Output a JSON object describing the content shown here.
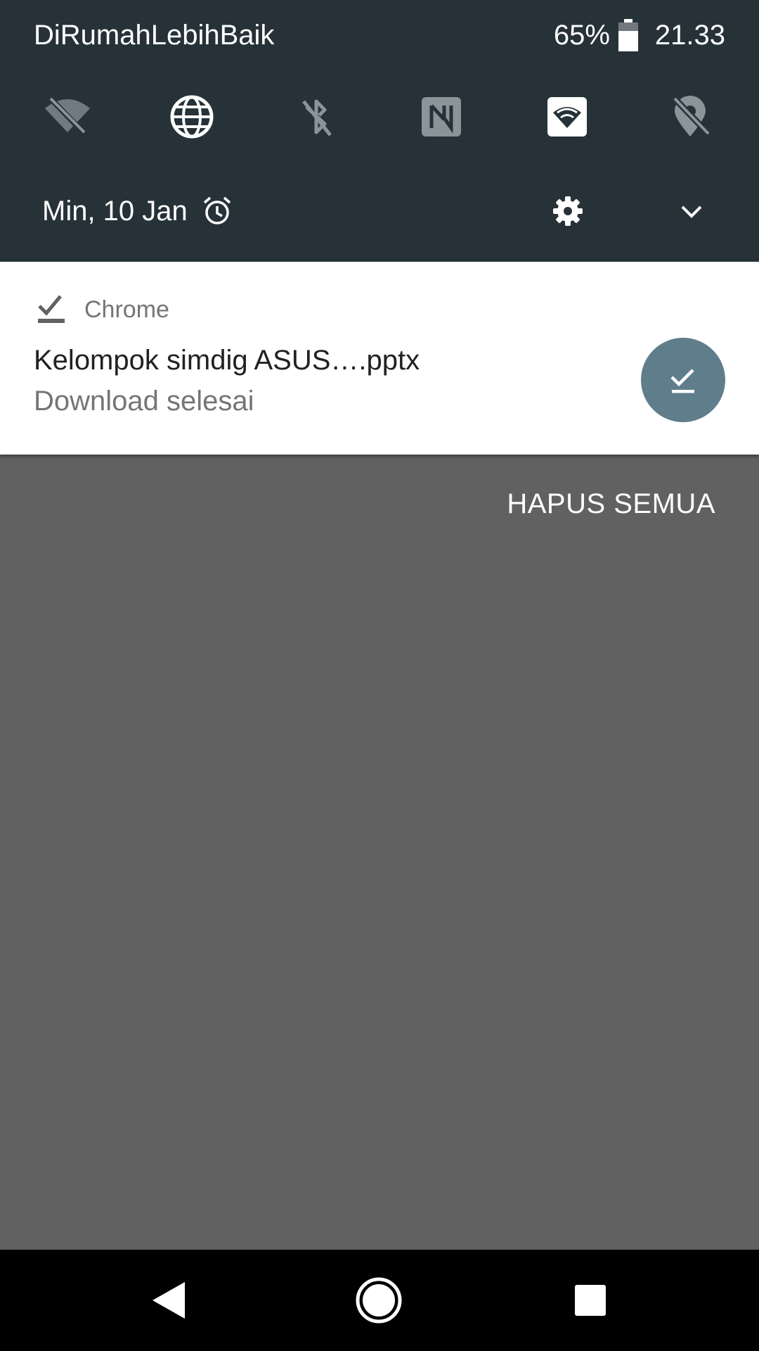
{
  "status_bar": {
    "carrier": "DiRumahLebihBaik",
    "battery_percent": "65%",
    "battery_level": 0.65,
    "time": "21.33"
  },
  "quick_settings": [
    {
      "name": "wifi-off-icon",
      "active": false
    },
    {
      "name": "globe-icon",
      "active": true
    },
    {
      "name": "bluetooth-off-icon",
      "active": false
    },
    {
      "name": "nfc-icon",
      "active": false
    },
    {
      "name": "hotspot-icon",
      "active": true
    },
    {
      "name": "location-off-icon",
      "active": false
    }
  ],
  "date_row": {
    "date": "Min, 10 Jan",
    "alarm_icon": "alarm-icon",
    "settings_icon": "gear-icon",
    "expand_icon": "chevron-down-icon"
  },
  "notification": {
    "app_name": "Chrome",
    "app_icon": "download-done-icon",
    "title": "Kelompok simdig ASUS….pptx",
    "text": "Download selesai",
    "action_icon": "download-done-icon",
    "action_color": "#607d8b"
  },
  "clear_all_label": "HAPUS SEMUA",
  "nav_bar": {
    "back_icon": "back-triangle-icon",
    "home_icon": "home-circle-icon",
    "recents_icon": "recents-square-icon"
  },
  "colors": {
    "panel_bg": "#263238",
    "shade_bg": "#616161",
    "inactive_icon": "#8a9499",
    "active_icon": "#ffffff"
  }
}
